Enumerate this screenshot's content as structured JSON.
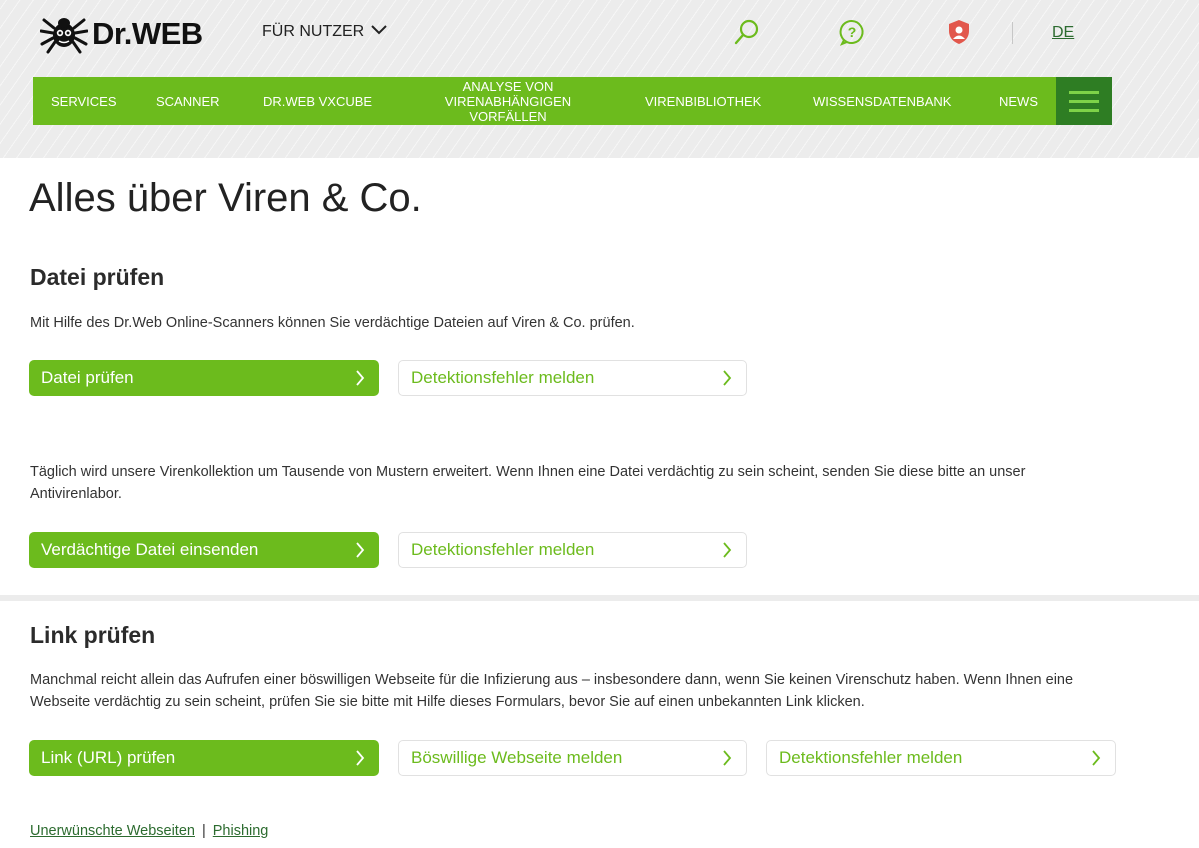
{
  "header": {
    "logo_text": "Dr.WEB",
    "audience_label": "FÜR NUTZER",
    "language": "DE",
    "icons": [
      "search-icon",
      "help-icon",
      "shield-user-icon"
    ]
  },
  "nav": {
    "items": [
      "SERVICES",
      "SCANNER",
      "DR.WEB VXCUBE",
      "ANALYSE VON VIRENABHÄNGIGEN VORFÄLLEN",
      "VIRENBIBLIOTHEK",
      "WISSENSDATENBANK",
      "NEWS"
    ]
  },
  "main": {
    "title": "Alles über Viren & Co.",
    "file_section": {
      "heading": "Datei prüfen",
      "description": "Mit Hilfe des Dr.Web Online-Scanners können Sie verdächtige Dateien auf Viren & Co. prüfen.",
      "primary_button": "Datei prüfen",
      "secondary_button": "Detektionsfehler melden"
    },
    "submit_section": {
      "description": "Täglich wird unsere Virenkollektion um Tausende von Mustern erweitert. Wenn Ihnen eine Datei verdächtig zu sein scheint, senden Sie diese bitte an unser Antivirenlabor.",
      "primary_button": "Verdächtige Datei einsenden",
      "secondary_button": "Detektionsfehler melden"
    },
    "link_section": {
      "heading": "Link prüfen",
      "description": "Manchmal reicht allein das Aufrufen einer böswilligen Webseite für die Infizierung aus – insbesondere dann, wenn Sie keinen Virenschutz haben. Wenn Ihnen eine Webseite verdächtig zu sein scheint, prüfen Sie sie bitte mit Hilfe dieses Formulars, bevor Sie auf einen unbekannten Link klicken.",
      "primary_button": "Link (URL) prüfen",
      "secondary_button": "Böswillige Webseite melden",
      "tertiary_button": "Detektionsfehler melden"
    },
    "footer_links": {
      "unwanted": "Unerwünschte Webseiten",
      "separator": "|",
      "phishing": "Phishing"
    }
  },
  "colors": {
    "brand_green": "#6cbb1d",
    "dark_green": "#2e7d23",
    "link_green": "#2c6b2f"
  }
}
